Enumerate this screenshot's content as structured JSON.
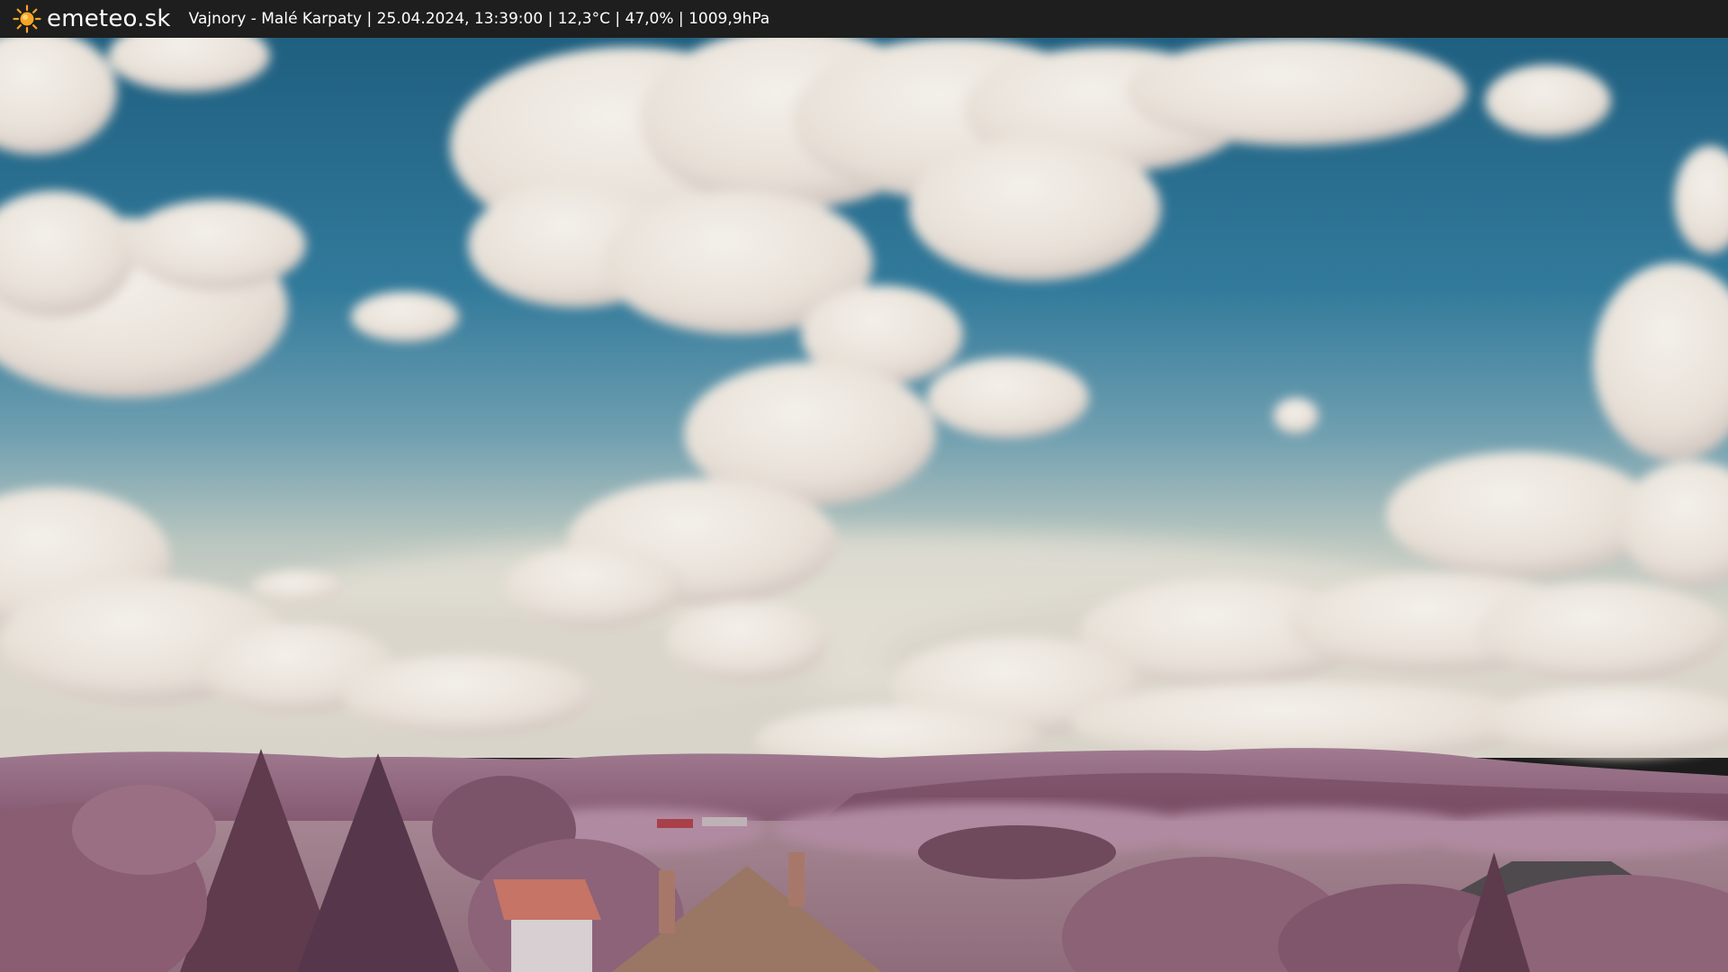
{
  "brand": {
    "name": "emeteo.sk",
    "icon": "sun-icon"
  },
  "caption": {
    "location": "Vajnory - Malé Karpaty",
    "datetime": "25.04.2024, 13:39:00",
    "temperature": "12,3°C",
    "humidity": "47,0%",
    "pressure": "1009,9hPa",
    "separator": " | "
  },
  "colors": {
    "bar": "#1e1e1e",
    "sun": "#f5a623",
    "sky_top": "#1f5f80",
    "sky_mid": "#3b80a0",
    "sky_horizon": "#c9cfc4",
    "hills": "#8c5d78",
    "foliage": "#9a6b80"
  }
}
